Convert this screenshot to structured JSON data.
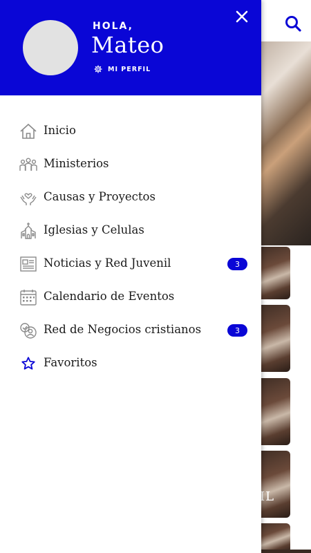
{
  "header": {
    "greeting": "HOLA,",
    "username": "Mateo",
    "profile_link": "MI PERFIL"
  },
  "menu": {
    "items": [
      {
        "label": "Inicio",
        "icon": "home-icon"
      },
      {
        "label": "Ministerios",
        "icon": "people-group-icon"
      },
      {
        "label": "Causas y Proyectos",
        "icon": "hands-heart-icon"
      },
      {
        "label": "Iglesias y Celulas",
        "icon": "church-icon"
      },
      {
        "label": "Noticias y Red Juvenil",
        "icon": "newspaper-icon",
        "badge": "3"
      },
      {
        "label": "Calendario de Eventos",
        "icon": "calendar-icon"
      },
      {
        "label": "Red de Negocios cristianos",
        "icon": "business-network-icon",
        "badge": "3"
      },
      {
        "label": "Favoritos",
        "icon": "star-icon"
      }
    ]
  },
  "background": {
    "partial_text": "IL"
  },
  "colors": {
    "brand": "#0a06d6",
    "icon_gray": "#8a8a8a",
    "text": "#1a1a1a"
  }
}
